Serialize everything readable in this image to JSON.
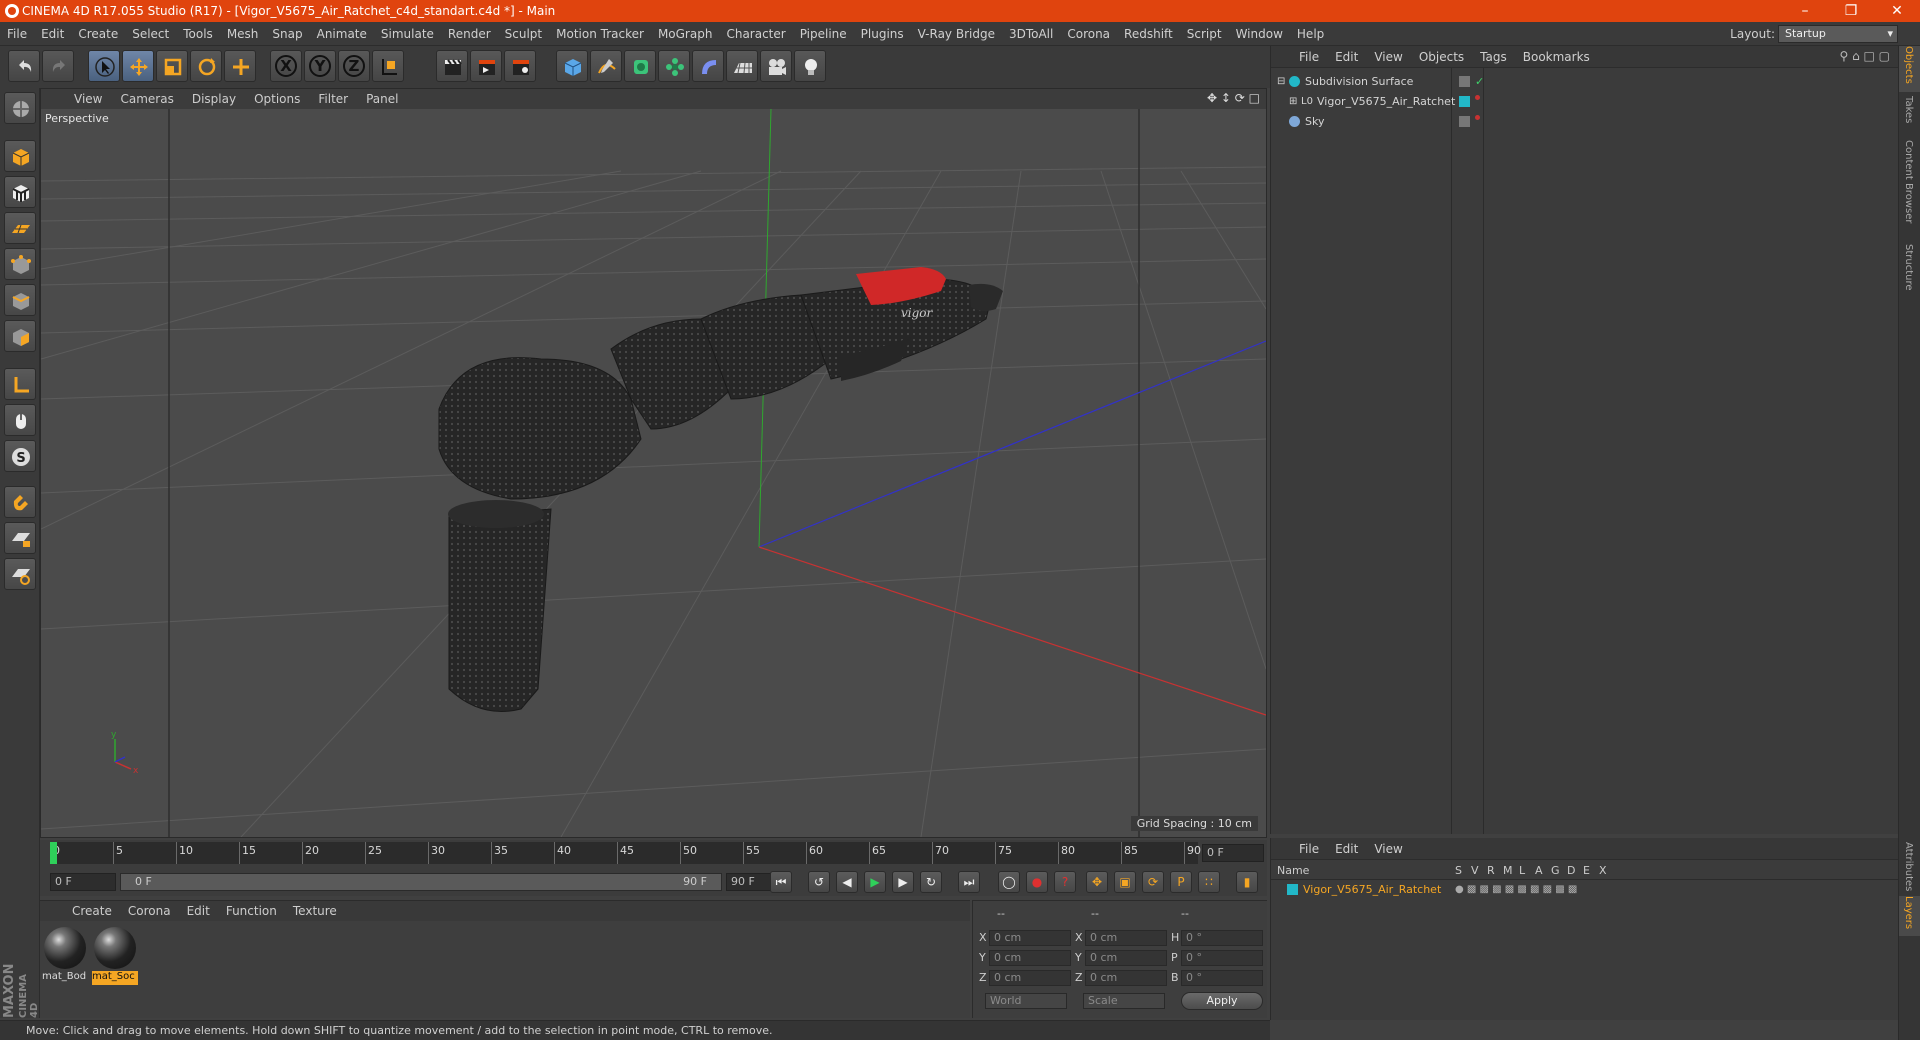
{
  "window": {
    "title": "CINEMA 4D R17.055 Studio (R17) - [Vigor_V5675_Air_Ratchet_c4d_standart.c4d *] - Main",
    "controls": [
      "minimize-icon",
      "restore-icon",
      "close-icon"
    ]
  },
  "menubar": {
    "items": [
      "File",
      "Edit",
      "Create",
      "Select",
      "Tools",
      "Mesh",
      "Snap",
      "Animate",
      "Simulate",
      "Render",
      "Sculpt",
      "Motion Tracker",
      "MoGraph",
      "Character",
      "Pipeline",
      "Plugins",
      "V-Ray Bridge",
      "3DToAll",
      "Corona",
      "Redshift",
      "Script",
      "Window",
      "Help"
    ],
    "layout_label": "Layout:",
    "layout_value": "Startup"
  },
  "toolbar": {
    "axis_x": "X",
    "axis_y": "Y",
    "axis_z": "Z"
  },
  "viewport": {
    "menu": [
      "View",
      "Cameras",
      "Display",
      "Options",
      "Filter",
      "Panel"
    ],
    "camera_label": "Perspective",
    "grid_spacing": "Grid Spacing : 10 cm"
  },
  "timeline": {
    "ticks": [
      "0",
      "5",
      "10",
      "15",
      "20",
      "25",
      "30",
      "35",
      "40",
      "45",
      "50",
      "55",
      "60",
      "65",
      "70",
      "75",
      "80",
      "85",
      "90"
    ],
    "current_frame": "0 F",
    "start_field": "0 F",
    "range_start": "0 F",
    "range_end": "90 F",
    "end_field": "90 F"
  },
  "materials": {
    "menu": [
      "Create",
      "Corona",
      "Edit",
      "Function",
      "Texture"
    ],
    "items": [
      {
        "name": "mat_Bod",
        "selected": false
      },
      {
        "name": "mat_Soc",
        "selected": true
      }
    ]
  },
  "coordinates": {
    "header": [
      "--",
      "--",
      "--"
    ],
    "rows": [
      {
        "pos_label": "X",
        "pos": "0 cm",
        "size_label": "X",
        "size": "0 cm",
        "rot_label": "H",
        "rot": "0 °"
      },
      {
        "pos_label": "Y",
        "pos": "0 cm",
        "size_label": "Y",
        "size": "0 cm",
        "rot_label": "P",
        "rot": "0 °"
      },
      {
        "pos_label": "Z",
        "pos": "0 cm",
        "size_label": "Z",
        "size": "0 cm",
        "rot_label": "B",
        "rot": "0 °"
      }
    ],
    "mode_world": "World",
    "mode_scale": "Scale",
    "apply_label": "Apply"
  },
  "statusbar": {
    "text": "Move: Click and drag to move elements. Hold down SHIFT to quantize movement / add to the selection in point mode, CTRL to remove."
  },
  "objects_panel": {
    "menu": [
      "File",
      "Edit",
      "View",
      "Objects",
      "Tags",
      "Bookmarks"
    ],
    "items": [
      {
        "name": "Subdivision Surface",
        "color": "#22b8c8"
      },
      {
        "name": "Vigor_V5675_Air_Ratchet",
        "color": "#22b8c8"
      },
      {
        "name": "Sky",
        "color": "#7fa8d8"
      }
    ]
  },
  "layers_panel": {
    "menu": [
      "File",
      "Edit",
      "View"
    ],
    "columns": [
      "Name",
      "S",
      "V",
      "R",
      "M",
      "L",
      "A",
      "G",
      "D",
      "E",
      "X"
    ],
    "rows": [
      {
        "name": "Vigor_V5675_Air_Ratchet",
        "color": "#22b8c8"
      }
    ]
  },
  "right_tabs": {
    "top": [
      "Objects",
      "Takes",
      "Content Browser",
      "Structure"
    ],
    "bottom": [
      "Attributes",
      "Layers"
    ]
  },
  "brand": {
    "line1": "MAXON",
    "line2": "CINEMA 4D"
  },
  "colors": {
    "title_bar": "#e0440e",
    "accent": "#f5a623",
    "axis_x": "#c83232",
    "axis_y": "#2fa82f",
    "axis_z": "#3232c8",
    "red_part": "#d02828"
  }
}
